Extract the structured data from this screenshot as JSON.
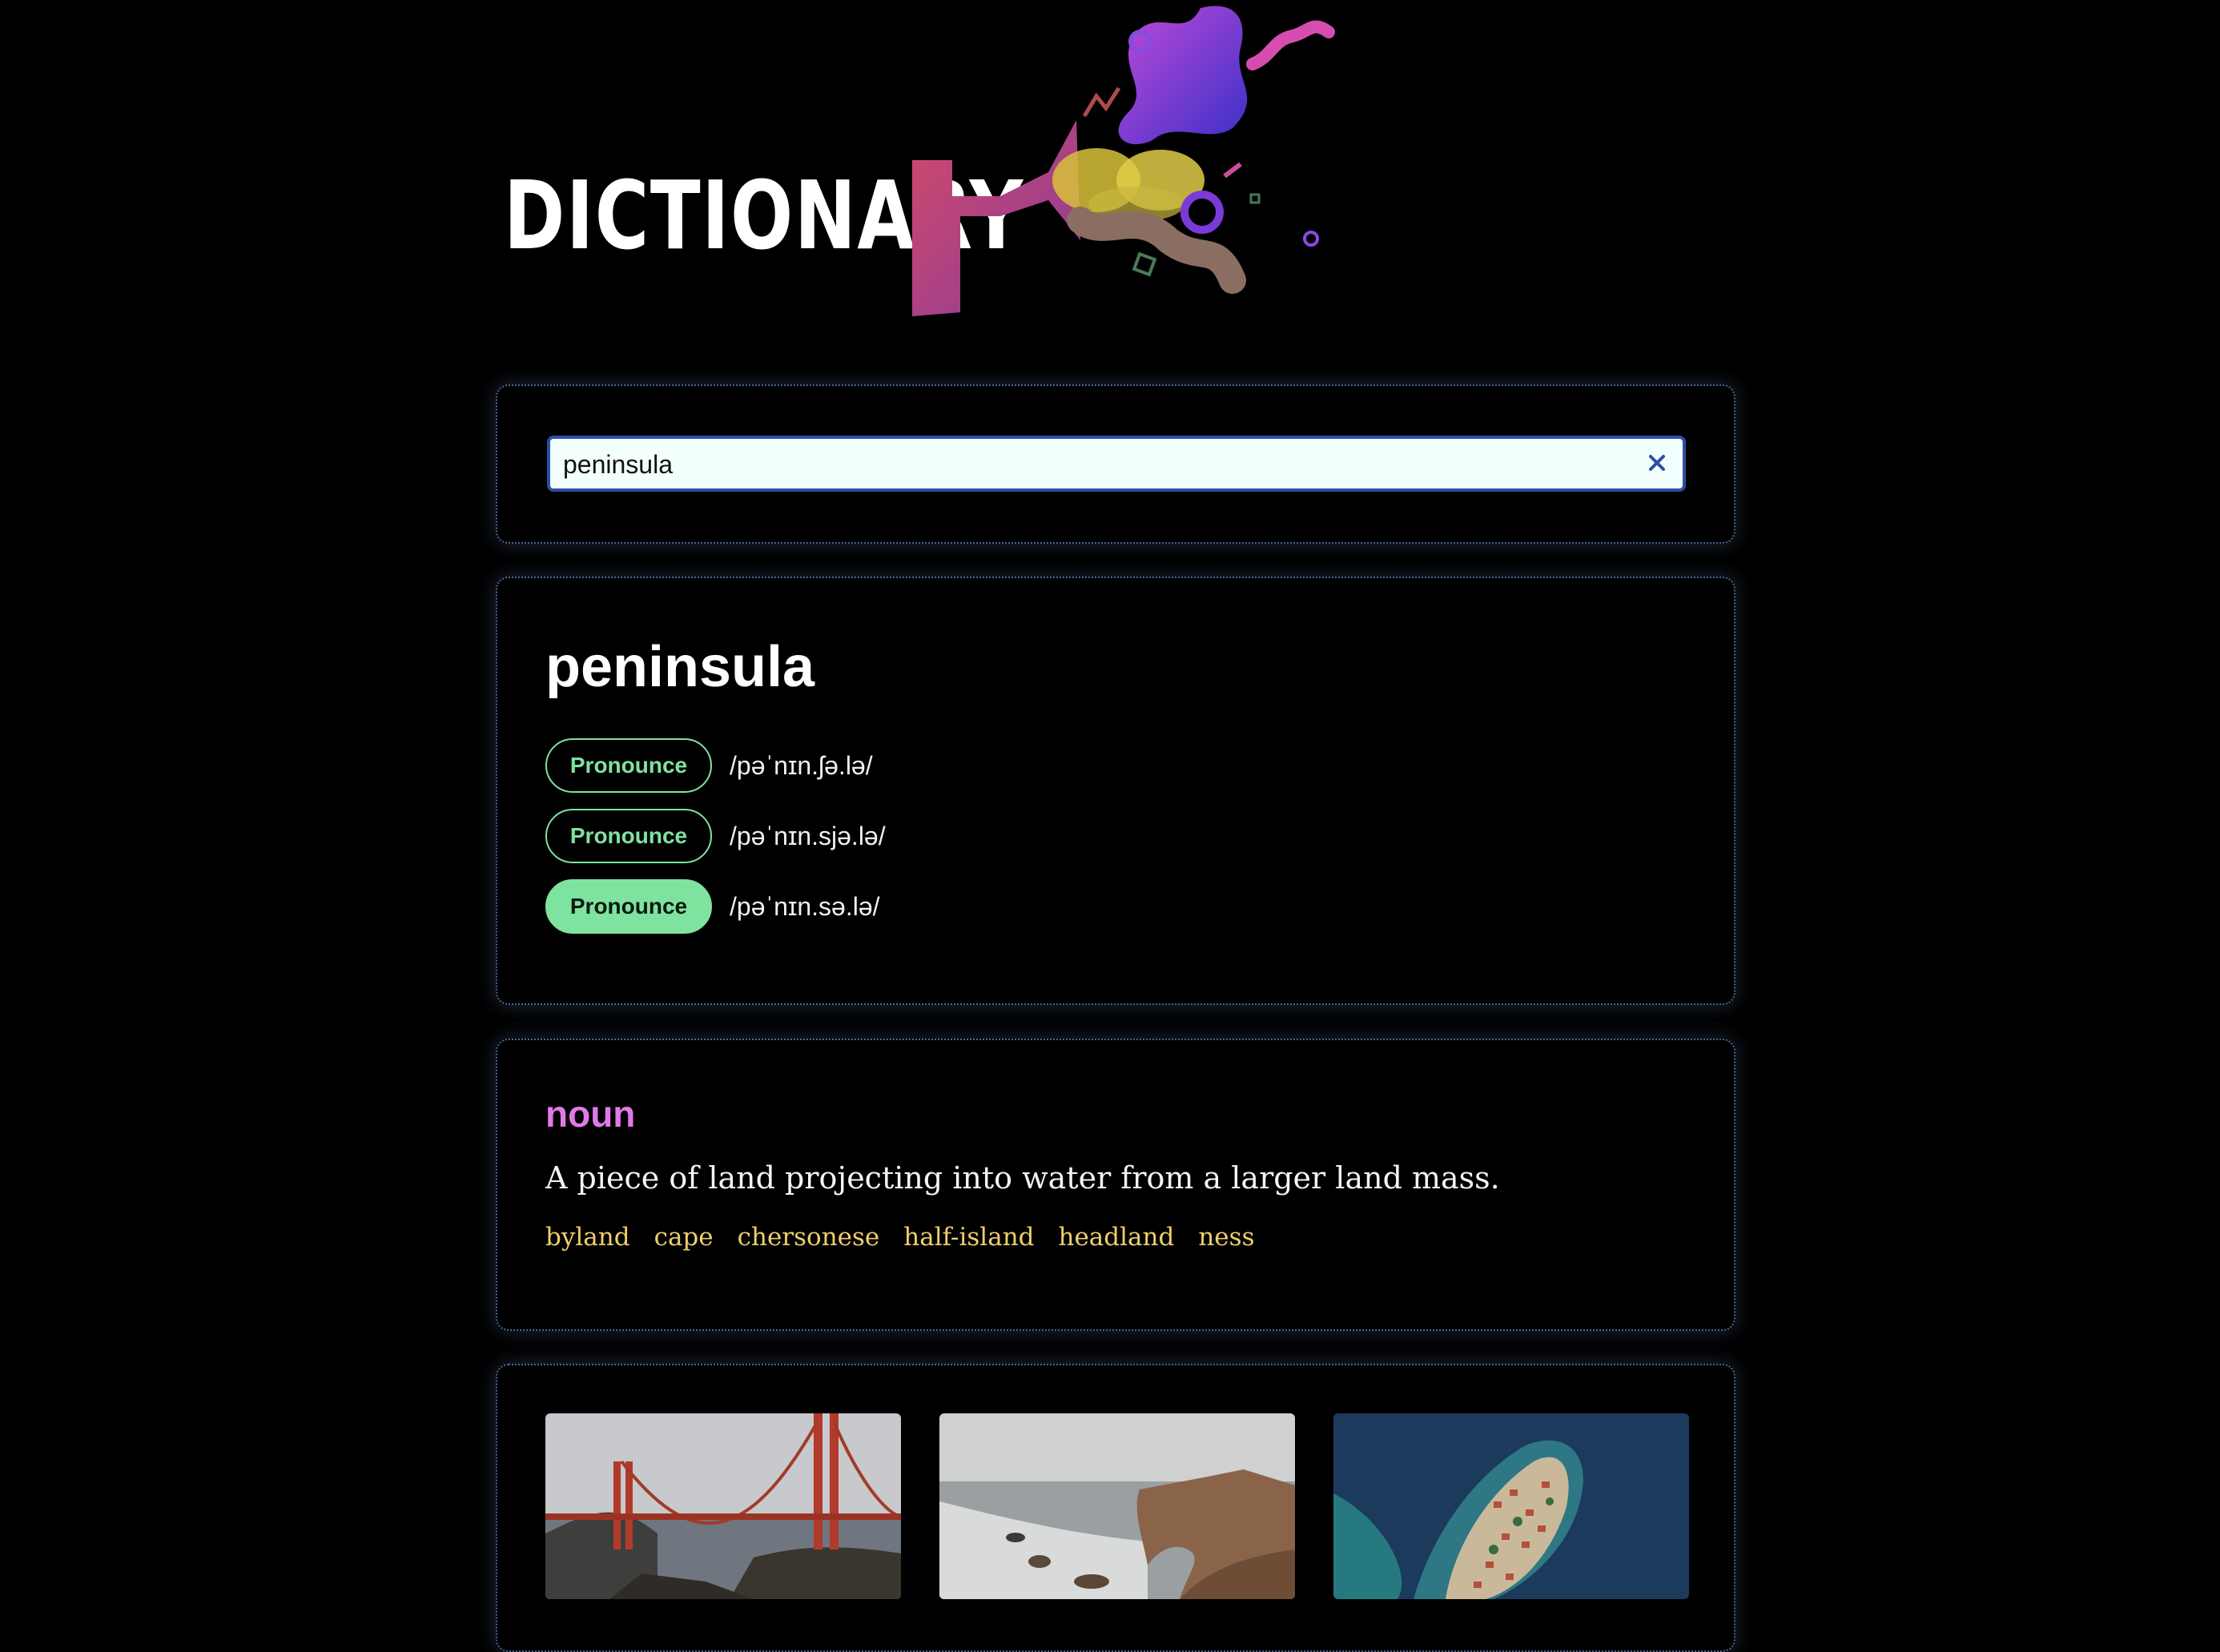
{
  "header": {
    "logo_text": "DICTIONARY"
  },
  "search": {
    "value": "peninsula"
  },
  "word": {
    "title": "peninsula",
    "pronunciations": [
      {
        "button_label": "Pronounce",
        "phonetic": "/pəˈnɪn.ʃə.lə/"
      },
      {
        "button_label": "Pronounce",
        "phonetic": "/pəˈnɪn.sjə.lə/"
      },
      {
        "button_label": "Pronounce",
        "phonetic": "/pəˈnɪn.sə.lə/"
      }
    ]
  },
  "meaning": {
    "part_of_speech": "noun",
    "definition": "A piece of land projecting into water from a larger land mass.",
    "synonyms": [
      "byland",
      "cape",
      "chersonese",
      "half-island",
      "headland",
      "ness"
    ]
  },
  "colors": {
    "accent_green": "#7fe3a0",
    "part_of_speech": "#e07ae8",
    "synonym": "#f0cf6a",
    "search_border": "#2d4fa3"
  }
}
